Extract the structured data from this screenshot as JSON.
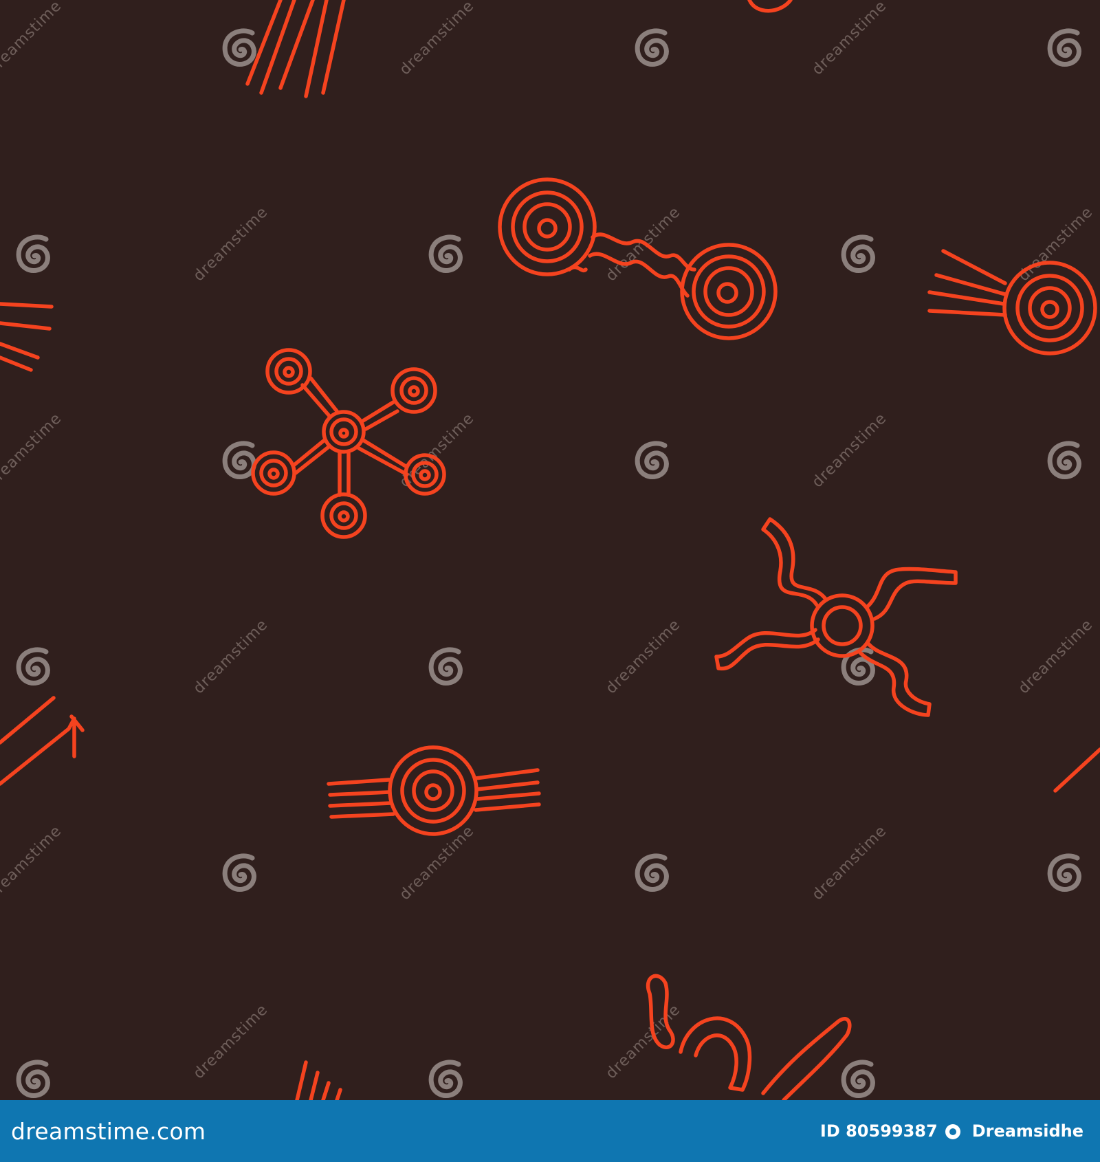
{
  "colors": {
    "background": "#301f1d",
    "motif": "#f5431f",
    "watermark_spiral": "#8b7f7c",
    "watermark_text": "#6e5e5a",
    "footer_bar": "#0f76b1",
    "footer_text": "#ffffff"
  },
  "watermark": {
    "text": "dreamstime"
  },
  "footer": {
    "brand": "dreamstime.com",
    "id_text": "ID 80599387",
    "separator": "©",
    "author": "Dreamsidhe"
  },
  "icons": {
    "watermark": "spiral-icon",
    "author": "dreamstime-logo-icon"
  }
}
